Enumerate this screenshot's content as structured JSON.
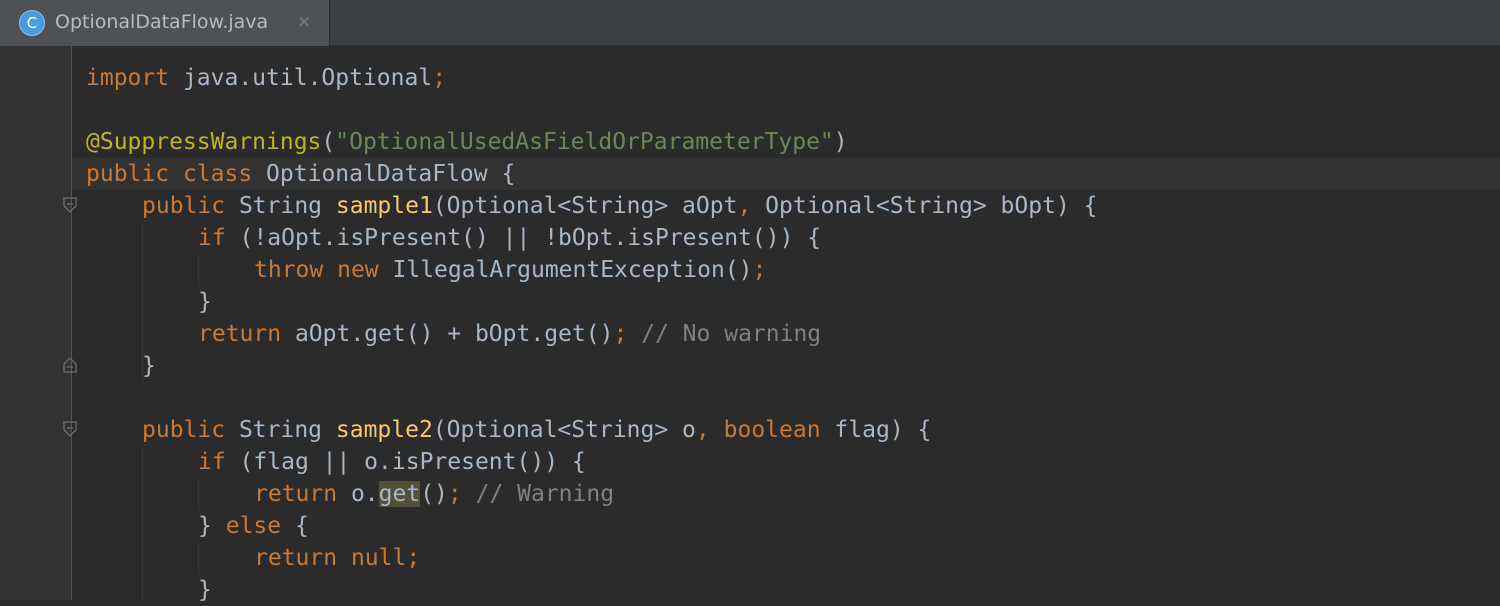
{
  "tab": {
    "icon_letter": "C",
    "title": "OptionalDataFlow.java",
    "close_glyph": "×"
  },
  "code": {
    "l1": {
      "t1": "import",
      "t2": " java.util.Optional",
      "t3": ";"
    },
    "l3": {
      "t1": "@SuppressWarnings",
      "t2": "(",
      "t3": "\"OptionalUsedAsFieldOrParameterType\"",
      "t4": ")"
    },
    "l4": {
      "t1": "public",
      "t2": " ",
      "t3": "class",
      "t4": " OptionalDataFlow {"
    },
    "l5": {
      "t1": "public",
      "t2": " String ",
      "t3": "sample1",
      "t4": "(Optional<String> aOpt",
      "t5": ",",
      "t6": " Optional<String> bOpt) {"
    },
    "l6": {
      "t1": "if",
      "t2": " (!aOpt.isPresent() || !bOpt.isPresent()) {"
    },
    "l7": {
      "t1": "throw",
      "t2": " ",
      "t3": "new",
      "t4": " IllegalArgumentException()",
      "t5": ";"
    },
    "l8": {
      "t1": "}"
    },
    "l9": {
      "t1": "return",
      "t2": " aOpt.get() + bOpt.get()",
      "t3": ";",
      "t4": " // No warning"
    },
    "l10": {
      "t1": "}"
    },
    "l12": {
      "t1": "public",
      "t2": " String ",
      "t3": "sample2",
      "t4": "(Optional<String> o",
      "t5": ",",
      "t6": " ",
      "t7": "boolean",
      "t8": " flag) {"
    },
    "l13": {
      "t1": "if",
      "t2": " (flag || o.isPresent()) {"
    },
    "l14": {
      "t1": "return",
      "t2": " o.",
      "t3": "get",
      "t4": "()",
      "t5": ";",
      "t6": " // Warning"
    },
    "l15": {
      "t1": "}",
      "t2": " ",
      "t3": "else",
      "t4": " {"
    },
    "l16": {
      "t1": "return",
      "t2": " ",
      "t3": "null",
      "t4": ";"
    },
    "l17": {
      "t1": "}"
    }
  },
  "colors": {
    "keyword": "#cc7832",
    "string": "#6a8759",
    "annotation": "#bbb529",
    "method": "#ffc66d",
    "comment": "#808080",
    "text": "#a9b7c6",
    "background": "#2b2b2b"
  }
}
